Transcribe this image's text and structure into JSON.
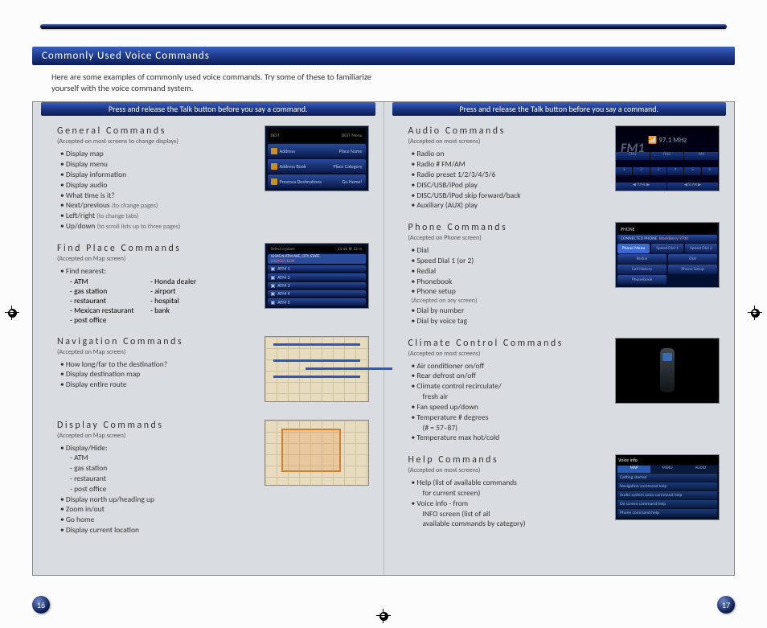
{
  "title": "Commonly Used Voice Commands",
  "intro": "Here are some examples of commonly used voice commands.  Try some of these to familiarize yourself with the voice command system.",
  "talk_banner": "Press and release the Talk button before you say a command.",
  "page_left": "16",
  "page_right": "17",
  "left": {
    "general": {
      "title": "General Commands",
      "sub": "(Accepted on most screens to change displays)",
      "items": [
        "Display map",
        "Display menu",
        "Display information",
        "Display audio",
        "What time is it?"
      ],
      "np_label": "Next/previous",
      "np_note": "(to change pages)",
      "lr_label": "Left/right",
      "lr_note": "(to change tabs)",
      "ud_label": "Up/down",
      "ud_note": "(to scroll lists up to three pages)",
      "dest_rows": [
        "Address",
        "Place Name",
        "Address Book",
        "Place Category",
        "Previous Destinations",
        "Go Home!"
      ]
    },
    "find": {
      "title": "Find Place Commands",
      "sub": "(Accepted on Map screen)",
      "lead": "Find nearest:",
      "col1": [
        "ATM",
        "gas station",
        "restaurant",
        "Mexican restaurant",
        "post office"
      ],
      "col2": [
        "Honda dealer",
        "airport",
        "hospital",
        "bank"
      ],
      "select_header": "Select a place",
      "select_addr": "12345 N ATM AVE, CITY, STATE",
      "select_phone": "(310)555-1234",
      "atm_rows": [
        "ATM 1",
        "ATM 2",
        "ATM 3",
        "ATM 4",
        "ATM 5"
      ]
    },
    "nav": {
      "title": "Navigation Commands",
      "sub": "(Accepted on Map screen)",
      "items": [
        "How long/far to the destination?",
        "Display destination map",
        "Display entire route"
      ]
    },
    "disp": {
      "title": "Display Commands",
      "sub": "(Accepted on Map screen)",
      "lead": "Display/Hide:",
      "subs": [
        "ATM",
        "gas station",
        "restaurant",
        "post office"
      ],
      "rest": [
        "Display north up/heading up",
        "Zoom in/out",
        "Go home",
        "Display current location"
      ]
    }
  },
  "right": {
    "audio": {
      "title": "Audio Commands",
      "sub": "(Accepted on most screens)",
      "items": [
        "Radio on",
        "Radio # FM/AM",
        "Radio preset 1/2/3/4/5/6",
        "DISC/USB/iPod play",
        "DISC/USB/iPod skip forward/back",
        "Auxiliary (AUX) play"
      ],
      "freq": "97.1 MHz",
      "fm": "FM1"
    },
    "phone": {
      "title": "Phone Commands",
      "sub": "(Accepted on Phone screen)",
      "items": [
        "Dial",
        "Speed Dial 1 (or 2)",
        "Redial",
        "Phonebook",
        "Phone setup"
      ],
      "any_note": "(Accepted on any screen)",
      "items2": [
        "Dial by number",
        "Dial by voice tag"
      ],
      "rows": {
        "top": "PHONE",
        "connected": "BlackBerry 9700",
        "tabs": [
          "Phone Menu",
          "Speed Dial 1",
          "Speed Dial 2"
        ],
        "btns": [
          "Redial",
          "Dial",
          "Call History",
          "Phone Setup",
          "Phonebook"
        ]
      }
    },
    "climate": {
      "title": "Climate Control Commands",
      "sub": "(Accepted on most screens)",
      "items": [
        "Air conditioner on/off",
        "Rear defrost on/off",
        "Climate control recirculate/ fresh air",
        "Fan speed up/down",
        "Temperature # degrees (# = 57–87)",
        "Temperature max hot/cold"
      ]
    },
    "help": {
      "title": "Help Commands",
      "sub": "(Accepted on most screens)",
      "items": [
        "Help (list of available commands for current screen)",
        "Voice info - from INFO screen (list of all available commands by category)"
      ],
      "rows": {
        "top": "Voice info",
        "tabs": [
          "MAP",
          "MENU",
          "AUDIO"
        ],
        "list": [
          "Getting started",
          "Navigation command help",
          "Audio system voice command help",
          "On screen command help",
          "Phone command help"
        ]
      }
    }
  }
}
